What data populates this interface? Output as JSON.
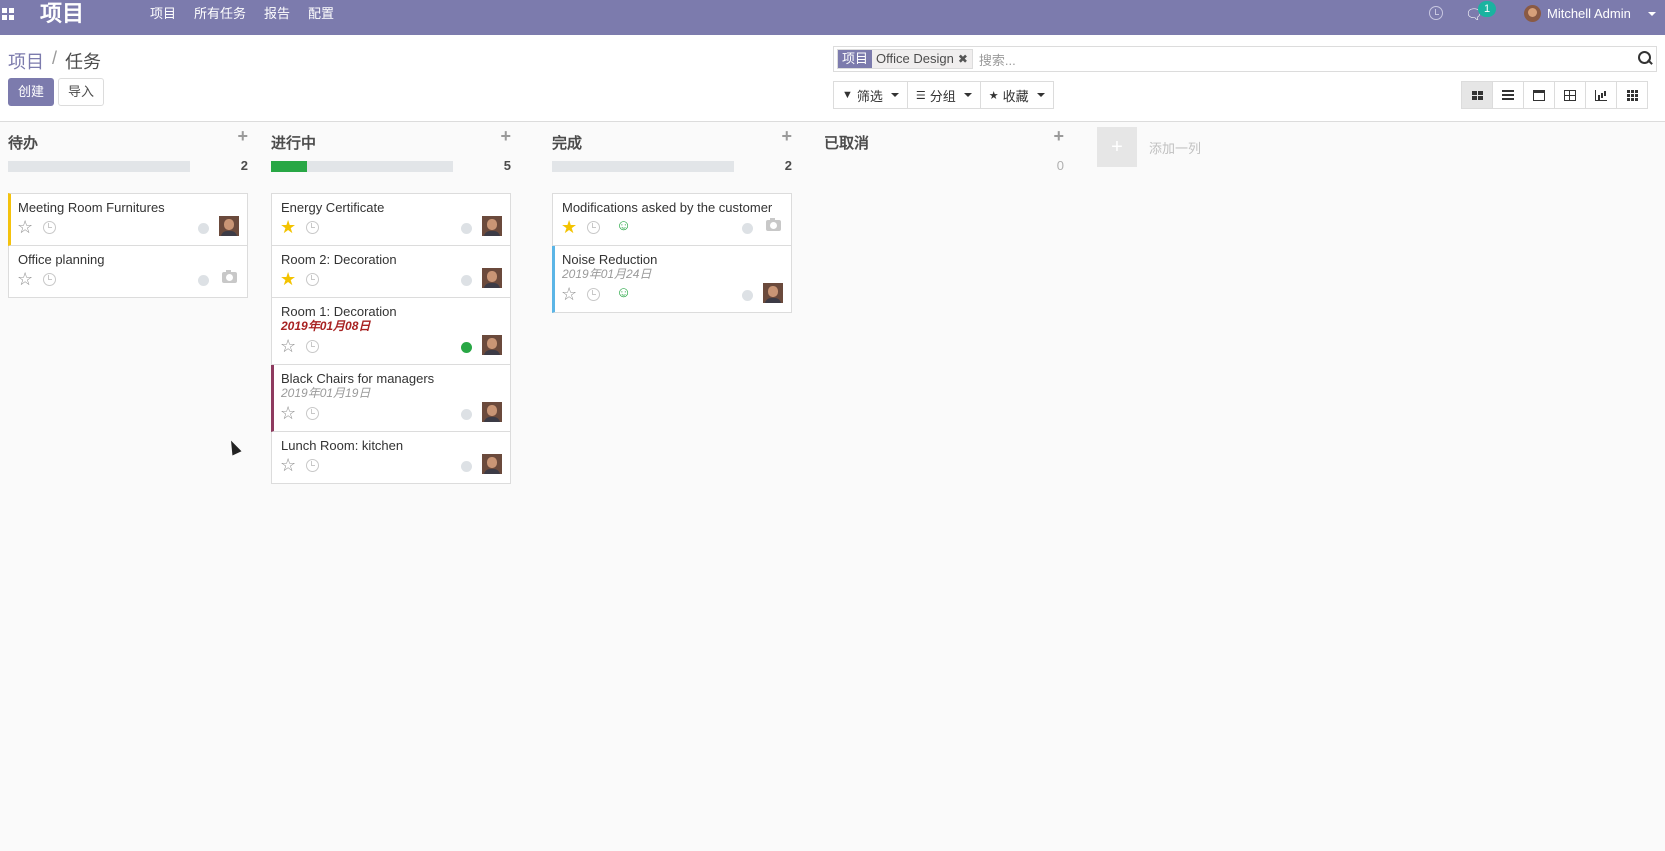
{
  "navbar": {
    "app_title": "项目",
    "menu": [
      "项目",
      "所有任务",
      "报告",
      "配置"
    ],
    "chat_count": "1",
    "user_name": "Mitchell Admin",
    "icons": [
      "apps-grid-icon",
      "clock-icon",
      "chat-icon",
      "user-avatar",
      "caret-down-icon"
    ]
  },
  "breadcrumb": {
    "parent": "项目",
    "separator": "/",
    "current": "任务"
  },
  "buttons": {
    "create": "创建",
    "import": "导入"
  },
  "search": {
    "facet_label": "项目",
    "facet_value": "Office Design",
    "facet_remove": "✖",
    "placeholder": "搜索..."
  },
  "filters": {
    "filter": "筛选",
    "group": "分组",
    "favorites": "收藏"
  },
  "views": [
    "kanban",
    "list",
    "calendar",
    "pivot",
    "graph",
    "grid"
  ],
  "active_view": "kanban",
  "colors": {
    "brand": "#7c7bad",
    "progress_done": "#28a745",
    "star_active": "#f3c300",
    "overdue": "#a82222"
  },
  "columns": [
    {
      "title": "待办",
      "count": "2",
      "progress": 0,
      "cards": [
        {
          "title": "Meeting Room Furnitures",
          "date": "",
          "starred": false,
          "state": "normal",
          "avatar": true,
          "color": "yellow"
        },
        {
          "title": "Office planning",
          "date": "",
          "starred": false,
          "state": "normal",
          "avatar": false,
          "color": ""
        }
      ]
    },
    {
      "title": "进行中",
      "count": "5",
      "progress": 0.2,
      "cards": [
        {
          "title": "Energy Certificate",
          "date": "",
          "starred": true,
          "state": "normal",
          "avatar": true,
          "color": ""
        },
        {
          "title": "Room 2: Decoration",
          "date": "",
          "starred": true,
          "state": "normal",
          "avatar": true,
          "color": ""
        },
        {
          "title": "Room 1: Decoration",
          "date": "2019年01月08日",
          "overdue": true,
          "starred": false,
          "state": "done",
          "avatar": true,
          "color": ""
        },
        {
          "title": "Black Chairs for managers",
          "date": "2019年01月19日",
          "starred": false,
          "state": "normal",
          "avatar": true,
          "color": "purple"
        },
        {
          "title": "Lunch Room: kitchen",
          "date": "",
          "starred": false,
          "state": "normal",
          "avatar": true,
          "color": ""
        }
      ]
    },
    {
      "title": "完成",
      "count": "2",
      "progress": 0,
      "cards": [
        {
          "title": "Modifications asked by the customer",
          "date": "",
          "starred": true,
          "smile": true,
          "state": "normal",
          "avatar": false,
          "color": ""
        },
        {
          "title": "Noise Reduction",
          "date": "2019年01月24日",
          "starred": false,
          "smile": true,
          "state": "normal",
          "avatar": true,
          "color": "blue"
        }
      ]
    },
    {
      "title": "已取消",
      "count": "0",
      "progress": null,
      "cards": []
    }
  ],
  "add_column": {
    "icon": "+",
    "label": "添加一列"
  }
}
